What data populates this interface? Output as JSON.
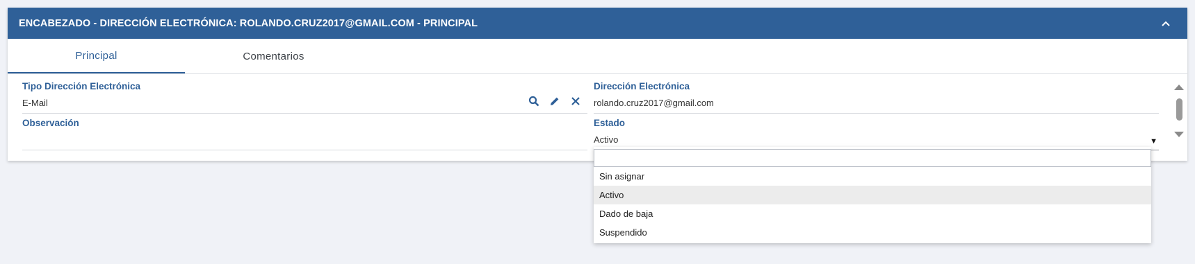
{
  "header": {
    "title": "ENCABEZADO - DIRECCIÓN ELECTRÓNICA: ROLANDO.CRUZ2017@GMAIL.COM - PRINCIPAL"
  },
  "tabs": [
    {
      "label": "Principal",
      "active": true
    },
    {
      "label": "Comentarios",
      "active": false
    }
  ],
  "form": {
    "tipo": {
      "label": "Tipo Dirección Electrónica",
      "value": "E-Mail"
    },
    "direccion": {
      "label": "Dirección Electrónica",
      "value": "rolando.cruz2017@gmail.com"
    },
    "observacion": {
      "label": "Observación",
      "value": ""
    },
    "estado": {
      "label": "Estado",
      "value": "Activo"
    }
  },
  "dropdown": {
    "search_value": "",
    "options": [
      "Sin asignar",
      "Activo",
      "Dado de baja",
      "Suspendido"
    ],
    "highlighted": "Activo"
  },
  "colors": {
    "accent": "#2f6098",
    "background": "#f0f2f7"
  }
}
